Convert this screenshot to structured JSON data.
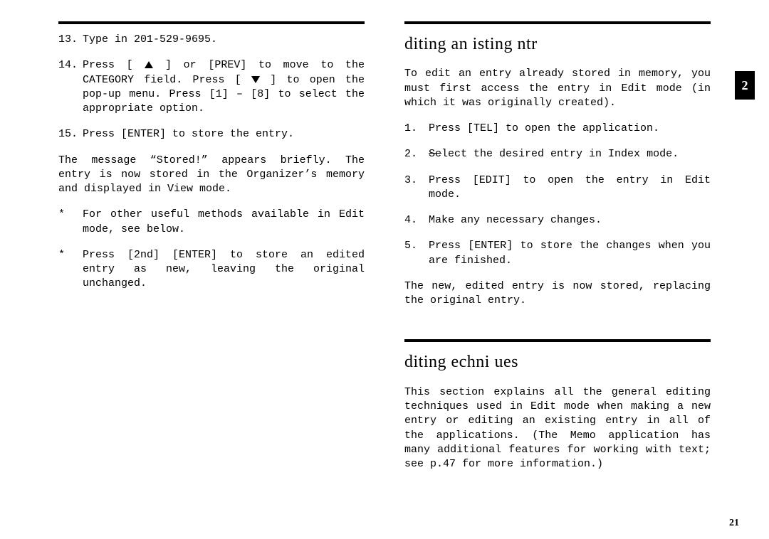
{
  "left": {
    "steps": [
      {
        "n": "13.",
        "t": "Type in 201-529-9695."
      },
      {
        "n": "14.",
        "t_pre": "Press [ ",
        "t_mid1": " ] or [PREV] to move to the CATEGORY field. Press [ ",
        "t_mid2": " ] to open the pop-up menu. Press [1] – [8] to select the appropriate option."
      },
      {
        "n": "15.",
        "t": "Press [ENTER] to store the entry."
      }
    ],
    "para1": "The message “Stored!” appears briefly. The entry is now stored in the Organizer’s memory and displayed in View mode.",
    "bullets": [
      "For other useful methods available in Edit mode, see below.",
      "Press [2nd] [ENTER] to store an edited entry as new, leaving the original unchanged."
    ]
  },
  "right": {
    "h1": "diting an  isting  ntr",
    "intro": "To edit an entry already stored in memory, you must first access the entry in Edit mode (in which it was originally created).",
    "steps": [
      {
        "n": "1.",
        "t": "Press [TEL] to open the application."
      },
      {
        "n": "2.",
        "t_strike": "Se",
        "t_rest": "lect the desired entry in Index mode."
      },
      {
        "n": "3.",
        "t": "Press [EDIT] to open the entry in Edit mode."
      },
      {
        "n": "4.",
        "t": "Make any necessary changes."
      },
      {
        "n": "5.",
        "t": "Press [ENTER] to store the changes when you are finished."
      }
    ],
    "outro": "The new, edited entry is now stored, replacing the original entry.",
    "h2": "diting  echni ues",
    "tech_para": "This section explains all the general editing techniques used in Edit mode when making a new entry or editing an existing entry in all of the applications. (The Memo application has many additional features for working with text; see p.47 for more information.)"
  },
  "tab": "2",
  "pagenum": "21"
}
